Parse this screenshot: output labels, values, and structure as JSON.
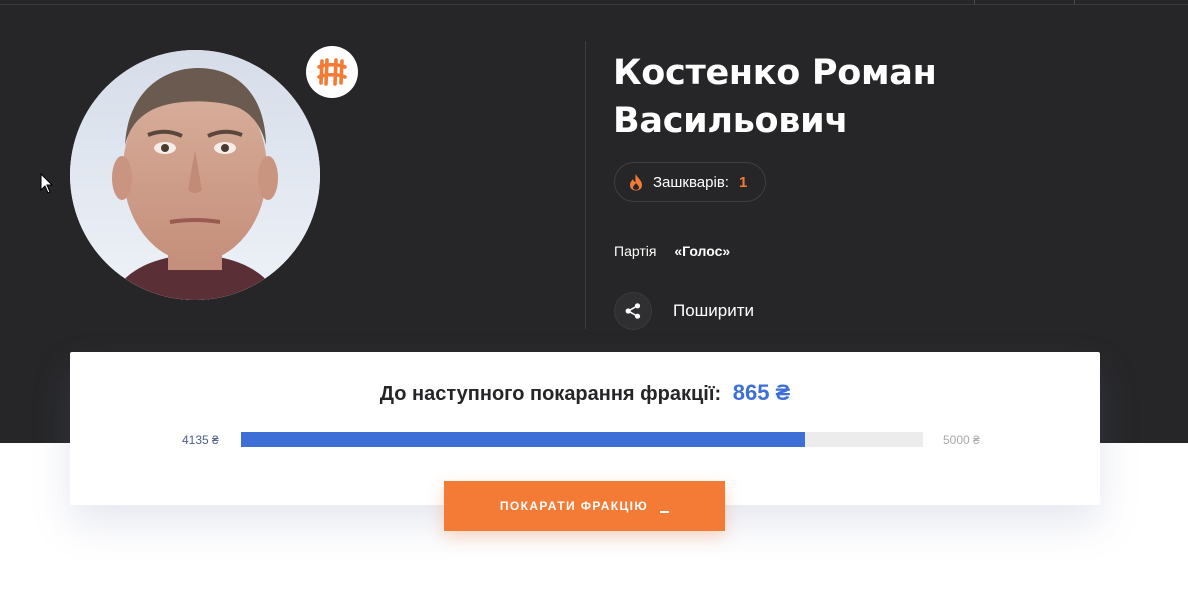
{
  "profile": {
    "name": "Костенко Роман Васильович",
    "scandals_label": "Зашкварів:",
    "scandals_count": "1",
    "party_label": "Партія",
    "party_name": "«Голос»",
    "share_label": "Поширити"
  },
  "fundraiser": {
    "goal_text": "До наступного покарання фракції:",
    "goal_amount": "865 ₴",
    "current": "4135 ₴",
    "target": "5000 ₴",
    "progress": 0.827,
    "button_label": "ПОКАРАТИ ФРАКЦІЮ"
  },
  "icons": {
    "party_logo": "holos-party-logo-icon",
    "scandal": "fire-icon",
    "share": "share-icon",
    "cursor": "mouse-pointer-icon"
  },
  "colors": {
    "accent": "#f47b36",
    "progress": "#3d6fd6",
    "hero_bg": "#262628"
  }
}
